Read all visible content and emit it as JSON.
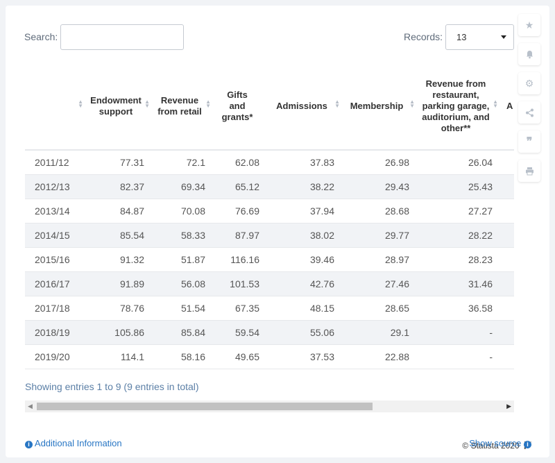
{
  "search": {
    "label": "Search:",
    "value": ""
  },
  "records": {
    "label": "Records:",
    "value": "13"
  },
  "table": {
    "columns": [
      "",
      "Endowment support",
      "Revenue from retail",
      "Gifts and grants*",
      "Admissions",
      "Membership",
      "Revenue from restaurant, parking garage, auditorium, and other**",
      "A f"
    ],
    "rows": [
      [
        "2011/12",
        "77.31",
        "72.1",
        "62.08",
        "37.83",
        "26.98",
        "26.04"
      ],
      [
        "2012/13",
        "82.37",
        "69.34",
        "65.12",
        "38.22",
        "29.43",
        "25.43"
      ],
      [
        "2013/14",
        "84.87",
        "70.08",
        "76.69",
        "37.94",
        "28.68",
        "27.27"
      ],
      [
        "2014/15",
        "85.54",
        "58.33",
        "87.97",
        "38.02",
        "29.77",
        "28.22"
      ],
      [
        "2015/16",
        "91.32",
        "51.87",
        "116.16",
        "39.46",
        "28.97",
        "28.23"
      ],
      [
        "2016/17",
        "91.89",
        "56.08",
        "101.53",
        "42.76",
        "27.46",
        "31.46"
      ],
      [
        "2017/18",
        "78.76",
        "51.54",
        "67.35",
        "48.15",
        "28.65",
        "36.58"
      ],
      [
        "2018/19",
        "105.86",
        "85.84",
        "59.54",
        "55.06",
        "29.1",
        "-"
      ],
      [
        "2019/20",
        "114.1",
        "58.16",
        "49.65",
        "37.53",
        "22.88",
        "-"
      ]
    ]
  },
  "footer": {
    "showing": "Showing entries 1 to 9 (9 entries in total)",
    "copyright": "© Statista 2020",
    "additional_info": "Additional Information",
    "show_source": "Show source"
  },
  "side_tools": [
    "star-icon",
    "bell-icon",
    "gear-icon",
    "share-icon",
    "quote-icon",
    "print-icon"
  ],
  "colors": {
    "link": "#2876c4",
    "stripe": "#f1f3f6",
    "showing": "#5b7fa6"
  }
}
